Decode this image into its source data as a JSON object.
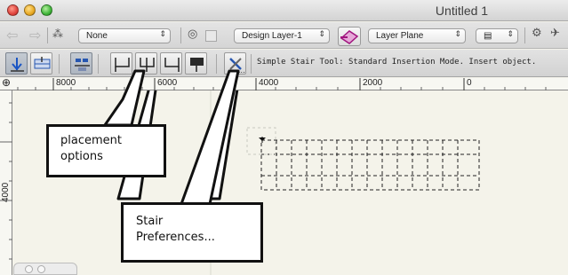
{
  "window": {
    "title": "Untitled 1"
  },
  "toolbar": {
    "class_popup": "None",
    "layer_popup": "Design Layer-1",
    "plane_popup": "Layer Plane"
  },
  "status": "Simple Stair Tool: Standard Insertion Mode. Insert object.",
  "ruler": {
    "top_labels": [
      "8000",
      "6000",
      "4000",
      "2000",
      "0"
    ],
    "left_labels": [
      "4000"
    ]
  },
  "callouts": {
    "placement": "placement options",
    "preferences": "Stair Preferences..."
  },
  "colors": {
    "callout_border": "#111111",
    "canvas": "#f4f3ea",
    "active_tool": "#b8bfc8"
  }
}
